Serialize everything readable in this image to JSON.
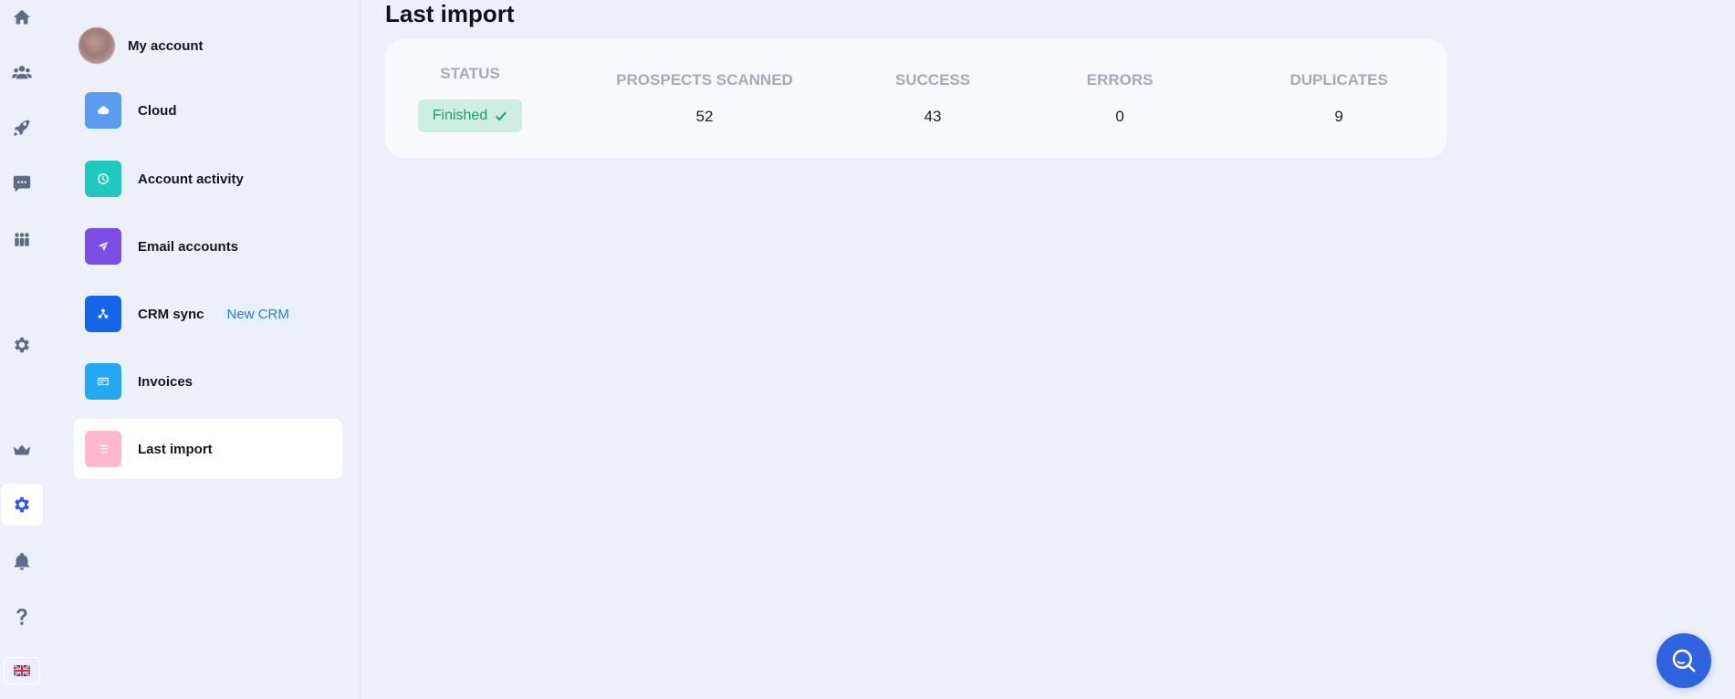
{
  "rail": {
    "items": [
      {
        "name": "home-icon"
      },
      {
        "name": "contacts-icon"
      },
      {
        "name": "campaigns-rocket-icon"
      },
      {
        "name": "messages-icon"
      },
      {
        "name": "team-icon"
      },
      {
        "name": "settings-icon"
      },
      {
        "name": "plan-crown-icon"
      },
      {
        "name": "account-settings-icon",
        "active": true
      },
      {
        "name": "notifications-bell-icon"
      },
      {
        "name": "help-icon"
      }
    ],
    "language": "UK flag"
  },
  "menu": {
    "my_account": "My account",
    "cloud": "Cloud",
    "account_activity": "Account activity",
    "email_accounts": "Email accounts",
    "crm_sync": "CRM sync",
    "crm_badge": "New CRM",
    "invoices": "Invoices",
    "last_import": "Last import"
  },
  "main": {
    "title": "Last import",
    "columns": {
      "status": "STATUS",
      "prospects_scanned": "PROSPECTS SCANNED",
      "success": "SUCCESS",
      "errors": "ERRORS",
      "duplicates": "DUPLICATES"
    },
    "row": {
      "status": "Finished",
      "prospects_scanned": "52",
      "success": "43",
      "errors": "0",
      "duplicates": "9"
    }
  },
  "colors": {
    "accent": "#2f5bea",
    "cloud": "#5b9bf0",
    "account_activity": "#1fc8c0",
    "email_accounts": "#7b4fe6",
    "crm_sync": "#1565e8",
    "invoices": "#22a8f4",
    "last_import": "#ffb6cf",
    "status_finished_bg": "#cfeee2",
    "status_finished_text": "#1f9c6d"
  }
}
